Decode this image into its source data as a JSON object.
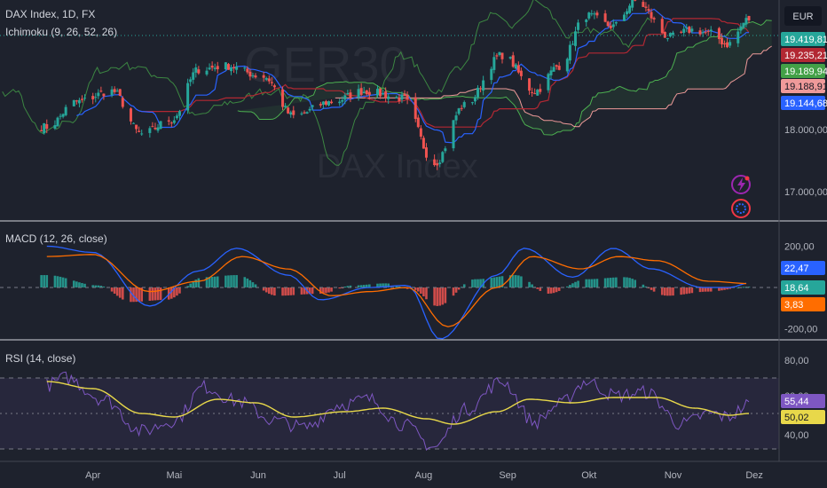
{
  "watermark": {
    "symbol": "GER30",
    "name": "DAX Index"
  },
  "currency_button": {
    "label": "EUR"
  },
  "panes": {
    "price": {
      "title": "DAX Index, 1D, FX",
      "indicator": "Ichimoku (9, 26, 52, 26)"
    },
    "macd": {
      "title": "MACD (12, 26, close)"
    },
    "rsi": {
      "title": "RSI (14, close)"
    }
  },
  "time_axis": [
    "Apr",
    "Mai",
    "Jun",
    "Jul",
    "Aug",
    "Sep",
    "Okt",
    "Nov",
    "Dez"
  ],
  "colors": {
    "background": "#1e222d",
    "up": "#26a69a",
    "down": "#ef5350",
    "tenkan": "#2962ff",
    "kijun": "#b22833",
    "span_a": "#4caf50",
    "span_b": "#ef9a9a",
    "lagging": "#43a047",
    "macd_line": "#2962ff",
    "signal_line": "#ff6d00",
    "rsi_line": "#7e57c2",
    "rsi_ma": "#e8d84a"
  },
  "chart_data": [
    {
      "type": "candlestick",
      "title": "DAX Index, 1D, FX",
      "indicator": "Ichimoku (9, 26, 52, 26)",
      "x": [
        "Apr",
        "Mai",
        "Jun",
        "Jul",
        "Aug",
        "Sep",
        "Okt",
        "Nov",
        "Dez"
      ],
      "y_ticks": [
        "18.000,00",
        "17.000,00"
      ],
      "ylim": [
        16600,
        19700
      ],
      "close_path": [
        {
          "date": "2024-03-15",
          "value": 17900
        },
        {
          "date": "2024-03-26",
          "value": 18250
        },
        {
          "date": "2024-04-08",
          "value": 18400
        },
        {
          "date": "2024-04-19",
          "value": 17800
        },
        {
          "date": "2024-04-30",
          "value": 18000
        },
        {
          "date": "2024-05-10",
          "value": 18700
        },
        {
          "date": "2024-05-20",
          "value": 18750
        },
        {
          "date": "2024-06-03",
          "value": 18600
        },
        {
          "date": "2024-06-14",
          "value": 18050
        },
        {
          "date": "2024-06-28",
          "value": 18250
        },
        {
          "date": "2024-07-10",
          "value": 18400
        },
        {
          "date": "2024-07-24",
          "value": 18300
        },
        {
          "date": "2024-08-05",
          "value": 17400
        },
        {
          "date": "2024-08-16",
          "value": 18200
        },
        {
          "date": "2024-08-30",
          "value": 18900
        },
        {
          "date": "2024-09-11",
          "value": 18400
        },
        {
          "date": "2024-09-20",
          "value": 18750
        },
        {
          "date": "2024-09-30",
          "value": 19450
        },
        {
          "date": "2024-10-10",
          "value": 19300
        },
        {
          "date": "2024-10-18",
          "value": 19650
        },
        {
          "date": "2024-10-31",
          "value": 19150
        },
        {
          "date": "2024-11-08",
          "value": 19250
        },
        {
          "date": "2024-11-15",
          "value": 19200
        },
        {
          "date": "2024-11-21",
          "value": 19050
        },
        {
          "date": "2024-11-29",
          "value": 19400
        }
      ],
      "last_values": [
        {
          "label": "19.419,81",
          "color": "#26a69a"
        },
        {
          "label": "19.235,21",
          "color": "#b22833"
        },
        {
          "label": "19.189,94",
          "color": "#43a047"
        },
        {
          "label": "19.188,91",
          "color": "#ef9a9a"
        },
        {
          "label": "19.144,68",
          "color": "#2962ff"
        }
      ]
    },
    {
      "type": "line",
      "title": "MACD (12, 26, close)",
      "y_ticks": [
        "200,00",
        "-200,00"
      ],
      "ylim": [
        -330,
        320
      ],
      "series": [
        {
          "role": "macd",
          "points": [
            {
              "date": "2024-03-15",
              "value": 200
            },
            {
              "date": "2024-04-01",
              "value": 170
            },
            {
              "date": "2024-04-22",
              "value": -90
            },
            {
              "date": "2024-05-10",
              "value": 80
            },
            {
              "date": "2024-05-24",
              "value": 190
            },
            {
              "date": "2024-06-12",
              "value": 60
            },
            {
              "date": "2024-06-24",
              "value": -60
            },
            {
              "date": "2024-07-12",
              "value": 0
            },
            {
              "date": "2024-07-26",
              "value": 10
            },
            {
              "date": "2024-08-07",
              "value": -250
            },
            {
              "date": "2024-08-28",
              "value": 60
            },
            {
              "date": "2024-09-07",
              "value": 190
            },
            {
              "date": "2024-09-25",
              "value": 50
            },
            {
              "date": "2024-10-10",
              "value": 190
            },
            {
              "date": "2024-10-24",
              "value": 90
            },
            {
              "date": "2024-11-12",
              "value": 0
            },
            {
              "date": "2024-11-22",
              "value": 0
            },
            {
              "date": "2024-11-29",
              "value": 22
            }
          ]
        },
        {
          "role": "signal",
          "points": [
            {
              "date": "2024-03-15",
              "value": 150
            },
            {
              "date": "2024-04-01",
              "value": 160
            },
            {
              "date": "2024-04-22",
              "value": -20
            },
            {
              "date": "2024-05-10",
              "value": 30
            },
            {
              "date": "2024-05-26",
              "value": 150
            },
            {
              "date": "2024-06-12",
              "value": 90
            },
            {
              "date": "2024-06-28",
              "value": -40
            },
            {
              "date": "2024-07-12",
              "value": -20
            },
            {
              "date": "2024-07-26",
              "value": 0
            },
            {
              "date": "2024-08-10",
              "value": -190
            },
            {
              "date": "2024-08-28",
              "value": 0
            },
            {
              "date": "2024-09-10",
              "value": 150
            },
            {
              "date": "2024-09-28",
              "value": 90
            },
            {
              "date": "2024-10-12",
              "value": 150
            },
            {
              "date": "2024-10-26",
              "value": 130
            },
            {
              "date": "2024-11-14",
              "value": 30
            },
            {
              "date": "2024-11-29",
              "value": 19
            }
          ]
        }
      ],
      "histogram_envelope": [
        {
          "date": "2024-03-15",
          "value": 60
        },
        {
          "date": "2024-04-03",
          "value": 10
        },
        {
          "date": "2024-04-15",
          "value": -70
        },
        {
          "date": "2024-04-28",
          "value": -60
        },
        {
          "date": "2024-05-12",
          "value": 50
        },
        {
          "date": "2024-05-24",
          "value": 60
        },
        {
          "date": "2024-06-08",
          "value": -40
        },
        {
          "date": "2024-06-24",
          "value": -30
        },
        {
          "date": "2024-07-06",
          "value": 10
        },
        {
          "date": "2024-07-18",
          "value": 20
        },
        {
          "date": "2024-07-28",
          "value": -10
        },
        {
          "date": "2024-08-06",
          "value": -90
        },
        {
          "date": "2024-08-20",
          "value": 40
        },
        {
          "date": "2024-09-04",
          "value": 60
        },
        {
          "date": "2024-09-16",
          "value": -30
        },
        {
          "date": "2024-09-30",
          "value": 40
        },
        {
          "date": "2024-10-14",
          "value": 50
        },
        {
          "date": "2024-10-30",
          "value": -40
        },
        {
          "date": "2024-11-14",
          "value": -20
        },
        {
          "date": "2024-11-29",
          "value": 4
        }
      ],
      "last_values": [
        {
          "label": "22,47",
          "color": "#2962ff"
        },
        {
          "label": "18,64",
          "color": "#26a69a"
        },
        {
          "label": "3,83",
          "color": "#ff6d00"
        }
      ]
    },
    {
      "type": "line",
      "title": "RSI (14, close)",
      "y_ticks": [
        "80,00",
        "60,00",
        "40,00"
      ],
      "ylim": [
        26,
        89
      ],
      "bands": {
        "upper": 70,
        "middle": 50,
        "lower": 30
      },
      "series": [
        {
          "role": "rsi",
          "points": [
            {
              "date": "2024-03-15",
              "value": 66
            },
            {
              "date": "2024-03-22",
              "value": 70
            },
            {
              "date": "2024-04-05",
              "value": 58
            },
            {
              "date": "2024-04-19",
              "value": 40
            },
            {
              "date": "2024-05-01",
              "value": 46
            },
            {
              "date": "2024-05-12",
              "value": 65
            },
            {
              "date": "2024-05-24",
              "value": 57
            },
            {
              "date": "2024-06-07",
              "value": 46
            },
            {
              "date": "2024-06-18",
              "value": 42
            },
            {
              "date": "2024-07-01",
              "value": 55
            },
            {
              "date": "2024-07-12",
              "value": 58
            },
            {
              "date": "2024-07-24",
              "value": 44
            },
            {
              "date": "2024-08-05",
              "value": 31
            },
            {
              "date": "2024-08-16",
              "value": 52
            },
            {
              "date": "2024-08-30",
              "value": 68
            },
            {
              "date": "2024-09-11",
              "value": 45
            },
            {
              "date": "2024-09-20",
              "value": 55
            },
            {
              "date": "2024-09-30",
              "value": 68
            },
            {
              "date": "2024-10-11",
              "value": 60
            },
            {
              "date": "2024-10-22",
              "value": 62
            },
            {
              "date": "2024-11-04",
              "value": 44
            },
            {
              "date": "2024-11-15",
              "value": 50
            },
            {
              "date": "2024-11-21",
              "value": 48
            },
            {
              "date": "2024-11-29",
              "value": 55
            }
          ]
        },
        {
          "role": "rsi_ma",
          "points": [
            {
              "date": "2024-03-15",
              "value": 68
            },
            {
              "date": "2024-04-01",
              "value": 64
            },
            {
              "date": "2024-04-19",
              "value": 50
            },
            {
              "date": "2024-05-01",
              "value": 48
            },
            {
              "date": "2024-05-17",
              "value": 58
            },
            {
              "date": "2024-05-31",
              "value": 56
            },
            {
              "date": "2024-06-14",
              "value": 48
            },
            {
              "date": "2024-07-03",
              "value": 51
            },
            {
              "date": "2024-07-17",
              "value": 53
            },
            {
              "date": "2024-08-02",
              "value": 47
            },
            {
              "date": "2024-08-12",
              "value": 44
            },
            {
              "date": "2024-08-28",
              "value": 51
            },
            {
              "date": "2024-09-09",
              "value": 58
            },
            {
              "date": "2024-09-25",
              "value": 56
            },
            {
              "date": "2024-10-10",
              "value": 59
            },
            {
              "date": "2024-10-26",
              "value": 59
            },
            {
              "date": "2024-11-09",
              "value": 53
            },
            {
              "date": "2024-11-22",
              "value": 49
            },
            {
              "date": "2024-11-29",
              "value": 50
            }
          ]
        }
      ],
      "last_values": [
        {
          "label": "55,44",
          "color": "#7e57c2"
        },
        {
          "label": "50,02",
          "color": "#e8d84a"
        }
      ]
    }
  ]
}
